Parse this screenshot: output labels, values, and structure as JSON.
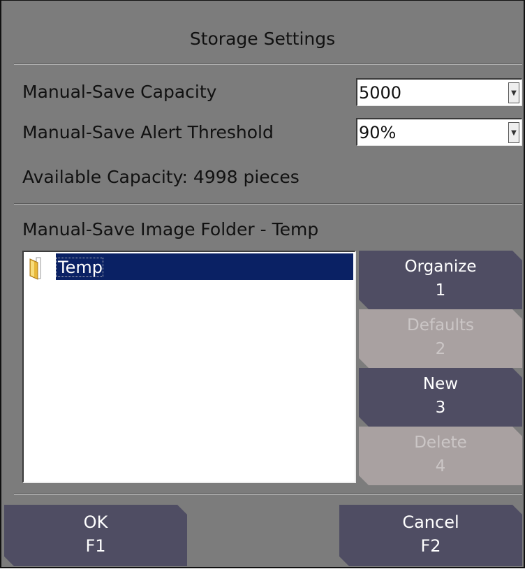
{
  "dialog": {
    "title": "Storage Settings"
  },
  "settings": {
    "capacity_label": "Manual-Save Capacity",
    "capacity_value": "5000",
    "threshold_label": "Manual-Save Alert Threshold",
    "threshold_value": "90%",
    "available_text": "Available Capacity: 4998 pieces"
  },
  "folder": {
    "heading": "Manual-Save Image Folder - Temp",
    "items": [
      {
        "label": "Temp",
        "selected": true
      }
    ]
  },
  "side_buttons": [
    {
      "label": "Organize",
      "key": "1",
      "enabled": true
    },
    {
      "label": "Defaults",
      "key": "2",
      "enabled": false
    },
    {
      "label": "New",
      "key": "3",
      "enabled": true
    },
    {
      "label": "Delete",
      "key": "4",
      "enabled": false
    }
  ],
  "footer": {
    "ok_label": "OK",
    "ok_key": "F1",
    "cancel_label": "Cancel",
    "cancel_key": "F2"
  },
  "colors": {
    "panel": "#7c7c7c",
    "button": "#4f4d63",
    "button_disabled": "#a9a1a1",
    "selection": "#0a2164"
  }
}
